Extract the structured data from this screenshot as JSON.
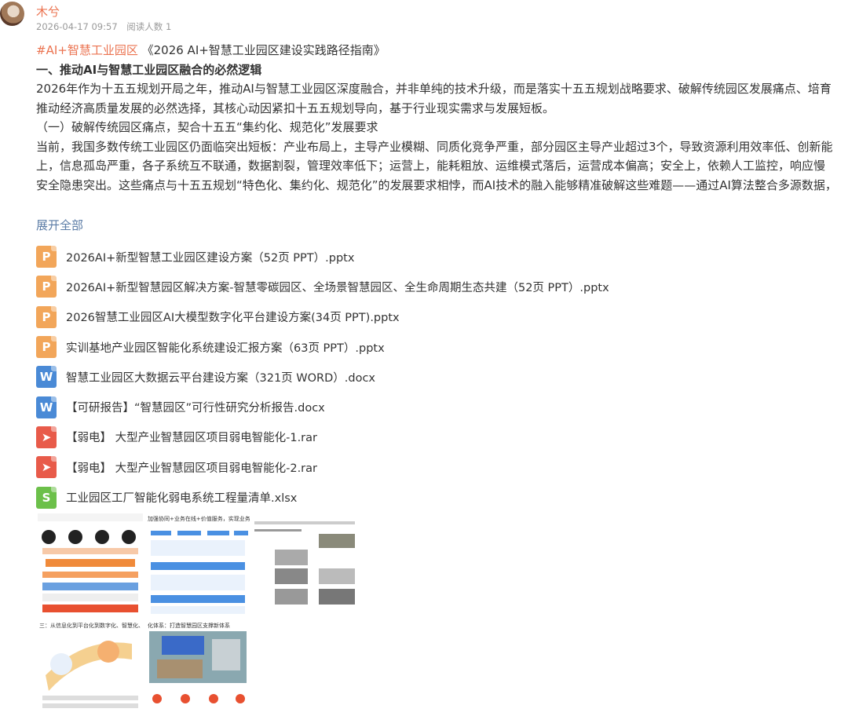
{
  "user": {
    "name": "木兮",
    "time": "2026-04-17 09:57",
    "reads": "阅读人数 1"
  },
  "post": {
    "hashtag": "#AI+智慧工业园区",
    "title": "《2026 AI+智慧工业园区建设实践路径指南》",
    "heading1": "一、推动AI与智慧工业园区融合的必然逻辑",
    "para1_line1": "2026年作为十五五规划开局之年，推动AI与智慧工业园区深度融合，并非单纯的技术升级，而是落实十五五规划战略要求、破解传统园区发展痛点、培育",
    "para1_line2": "推动经济高质量发展的必然选择，其核心动因紧扣十五五规划导向，基于行业现实需求与发展短板。",
    "heading2": "（一）破解传统园区痛点，契合十五五“集约化、规范化”发展要求",
    "para2_line1": "当前，我国多数传统工业园区仍面临突出短板：产业布局上，主导产业模糊、同质化竞争严重，部分园区主导产业超过3个，导致资源利用效率低、创新能",
    "para2_line2": "上，信息孤岛严重，各子系统互不联通，数据割裂，管理效率低下；运营上，能耗粗放、运维模式落后，运营成本偏高；安全上，依赖人工监控，响应慢",
    "para2_line3": "安全隐患突出。这些痛点与十五五规划“特色化、集约化、规范化”的发展要求相悖，而AI技术的融入能够精准破解这些难题——通过AI算法整合多源数据，"
  },
  "expand_label": "展开全部",
  "files": [
    {
      "type": "ppt",
      "icon": "P",
      "name": "2026AI+新型智慧工业园区建设方案（52页 PPT）.pptx"
    },
    {
      "type": "ppt",
      "icon": "P",
      "name": "2026AI+新型智慧园区解决方案-智慧零碳园区、全场景智慧园区、全生命周期生态共建（52页 PPT）.pptx"
    },
    {
      "type": "ppt",
      "icon": "P",
      "name": "2026智慧工业园区AI大模型数字化平台建设方案(34页 PPT).pptx"
    },
    {
      "type": "ppt",
      "icon": "P",
      "name": "实训基地产业园区智能化系统建设汇报方案（63页 PPT）.pptx"
    },
    {
      "type": "doc",
      "icon": "W",
      "name": "智慧工业园区大数据云平台建设方案（321页 WORD）.docx"
    },
    {
      "type": "doc",
      "icon": "W",
      "name": "【可研报告】“智慧园区”可行性研究分析报告.docx"
    },
    {
      "type": "rar",
      "icon": "➤",
      "name": "【弱电】 大型产业智慧园区项目弱电智能化-1.rar"
    },
    {
      "type": "rar",
      "icon": "➤",
      "name": "【弱电】 大型产业智慧园区项目弱电智能化-2.rar"
    },
    {
      "type": "xls",
      "icon": "S",
      "name": "工业园区工厂智能化弱电系统工程量清单.xlsx"
    }
  ],
  "thumbs": [
    {
      "caption": ""
    },
    {
      "caption": "加强协同+业务在线+价值服务，实现业务闭环"
    },
    {
      "caption": ""
    },
    {
      "caption": "三：从信息化到平台化到数字化、智慧化、低碳化"
    },
    {
      "caption": "化体系：打造智慧园区支撑新体系"
    }
  ],
  "colors": {
    "accent": "#eb7350",
    "link": "#5b7ca6",
    "ppt": "#f2a65a",
    "doc": "#4a8ad6",
    "rar": "#e85b4a",
    "xls": "#6cc04a"
  }
}
